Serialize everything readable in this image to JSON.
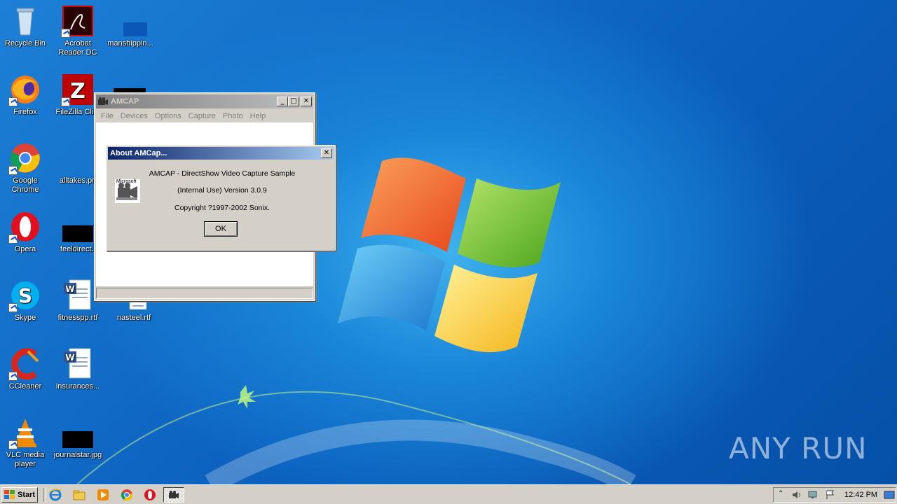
{
  "desktop": {
    "icons": [
      {
        "label": "Recycle Bin",
        "icon": "recycle-bin-icon"
      },
      {
        "label": "Acrobat Reader DC",
        "icon": "acrobat-icon"
      },
      {
        "label": "manshippin...",
        "icon": "file-icon"
      },
      {
        "label": "Firefox",
        "icon": "firefox-icon"
      },
      {
        "label": "FileZilla Cli...",
        "icon": "filezilla-icon"
      },
      {
        "label": "Google Chrome",
        "icon": "chrome-icon"
      },
      {
        "label": "alltakes.pn",
        "icon": "image-file-icon"
      },
      {
        "label": "Opera",
        "icon": "opera-icon"
      },
      {
        "label": "feeldirect.j",
        "icon": "image-file-icon"
      },
      {
        "label": "Skype",
        "icon": "skype-icon"
      },
      {
        "label": "fitnesspp.rtf",
        "icon": "word-doc-icon"
      },
      {
        "label": "nasteel.rtf",
        "icon": "word-doc-icon"
      },
      {
        "label": "CCleaner",
        "icon": "ccleaner-icon"
      },
      {
        "label": "insurances...",
        "icon": "word-doc-icon"
      },
      {
        "label": "VLC media player",
        "icon": "vlc-icon"
      },
      {
        "label": "journalstar.jpg",
        "icon": "image-file-icon"
      }
    ],
    "watermark": "ANY RUN"
  },
  "amcap": {
    "title": "AMCAP",
    "menu": [
      "File",
      "Devices",
      "Options",
      "Capture",
      "Photo",
      "Help"
    ]
  },
  "about": {
    "title": "About AMCap...",
    "line1": "AMCAP - DirectShow Video Capture Sample",
    "line2": "(Internal Use) Version 3.0.9",
    "line3": "Copyright ?1997-2002 Sonix.",
    "ok": "OK",
    "logo_text": "Microsoft"
  },
  "taskbar": {
    "start": "Start",
    "clock": "12:42 PM"
  },
  "colors": {
    "active_title": "#0a246a",
    "inactive_title": "#808080",
    "face": "#d4d0c8"
  }
}
